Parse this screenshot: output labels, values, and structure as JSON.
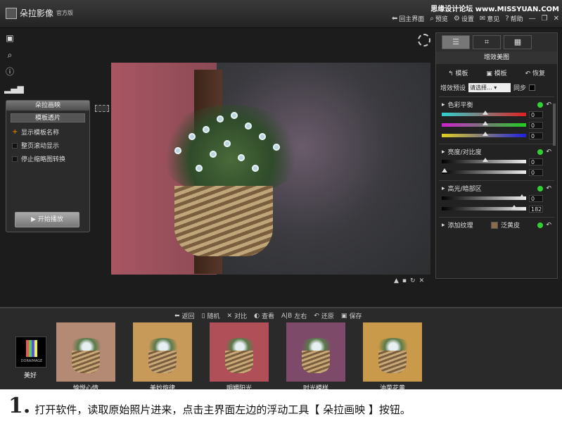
{
  "app": {
    "name": "朵拉影像",
    "edition": "官方版",
    "brand": "DORAIMAGE"
  },
  "watermark": "思缘设计论坛 www.MISSYUAN.COM",
  "top_menu": [
    {
      "icon": "back-arrow-icon",
      "label": "回主界面"
    },
    {
      "icon": "magnify-icon",
      "label": "预览"
    },
    {
      "icon": "gear-icon",
      "label": "设置"
    },
    {
      "icon": "chat-icon",
      "label": "意见"
    },
    {
      "icon": "help-icon",
      "label": "帮助"
    }
  ],
  "float_panel": {
    "title": "朵拉画映",
    "tab": "模板透片",
    "options": [
      "显示模板名称",
      "整页滚动显示",
      "停止缩略图转换"
    ],
    "start_button": "开始播放"
  },
  "right_panel": {
    "title": "增效美图",
    "actions": [
      "模板",
      "模板",
      "恢复"
    ],
    "preset_label": "增效预设",
    "preset_value": "请选择...",
    "sync_label": "同步",
    "sections": [
      {
        "title": "色彩平衡",
        "sliders": [
          {
            "value": "0",
            "pos": 0.5
          },
          {
            "value": "0",
            "pos": 0.5
          },
          {
            "value": "0",
            "pos": 0.5
          }
        ]
      },
      {
        "title": "亮度/对比度",
        "sliders": [
          {
            "value": "0",
            "pos": 0.5
          },
          {
            "value": "0",
            "pos": 0.0
          }
        ]
      },
      {
        "title": "高光/暗部区",
        "sliders": [
          {
            "value": "0",
            "pos": 0.95
          },
          {
            "value": "182",
            "pos": 0.85
          }
        ]
      },
      {
        "title": "添加纹理",
        "texture": "泛黄皮"
      }
    ]
  },
  "bottom_toolbar": [
    "返回",
    "随机",
    "对比",
    "查看",
    "左右",
    "还原",
    "保存"
  ],
  "bottom_logo": {
    "brand": "DORAIMAGE",
    "name": "美好"
  },
  "thumbnails": [
    {
      "label": "愉悦心情",
      "tint": "#b58a74"
    },
    {
      "label": "美妙旋律",
      "tint": "#c79a5a"
    },
    {
      "label": "明媚阳光",
      "tint": "#b04f58"
    },
    {
      "label": "时光模样",
      "tint": "#7d4a6a"
    },
    {
      "label": "油菜花黄",
      "tint": "#c99a4a"
    }
  ],
  "caption": {
    "number": "1.",
    "text": "打开软件，读取原始照片进来，点击主界面左边的浮动工具【 朵拉画映 】按钮。"
  }
}
